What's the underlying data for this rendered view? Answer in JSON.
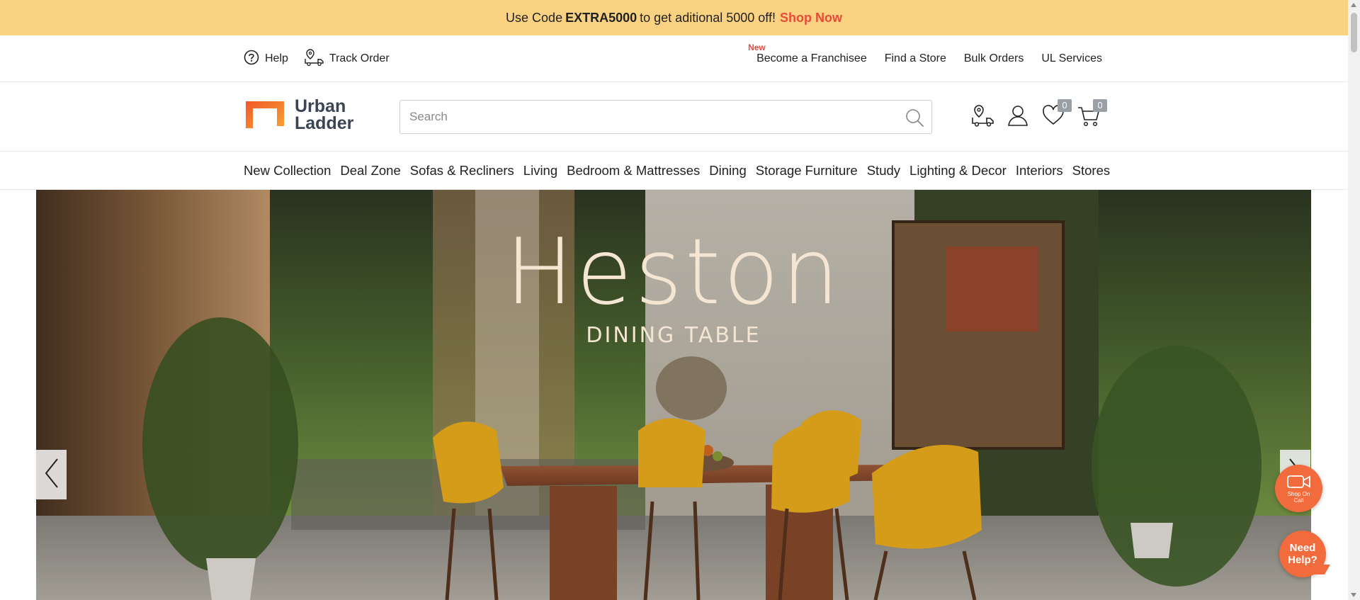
{
  "promo": {
    "text_before": "Use Code",
    "code": "EXTRA5000",
    "text_after": "to get aditional 5000 off!",
    "cta": "Shop Now",
    "background": "#fbd281",
    "cta_color": "#e84b3a"
  },
  "utility": {
    "help_label": "Help",
    "track_order_label": "Track Order",
    "new_tag": "New",
    "links": [
      "Become a Franchisee",
      "Find a Store",
      "Bulk Orders",
      "UL Services"
    ]
  },
  "header": {
    "logo_line1": "Urban",
    "logo_line2": "Ladder",
    "brand_color": "#f26b3d",
    "search_placeholder": "Search",
    "wishlist_count": "0",
    "cart_count": "0"
  },
  "nav": {
    "categories": [
      "New Collection",
      "Deal Zone",
      "Sofas & Recliners",
      "Living",
      "Bedroom & Mattresses",
      "Dining",
      "Storage Furniture",
      "Study",
      "Lighting & Decor",
      "Interiors",
      "Stores"
    ]
  },
  "hero": {
    "title": "Heston",
    "subtitle": "DINING TABLE"
  },
  "widgets": {
    "shop_call_line1": "Shop On",
    "shop_call_line2": "Call",
    "need_help_line1": "Need",
    "need_help_line2": "Help?"
  }
}
